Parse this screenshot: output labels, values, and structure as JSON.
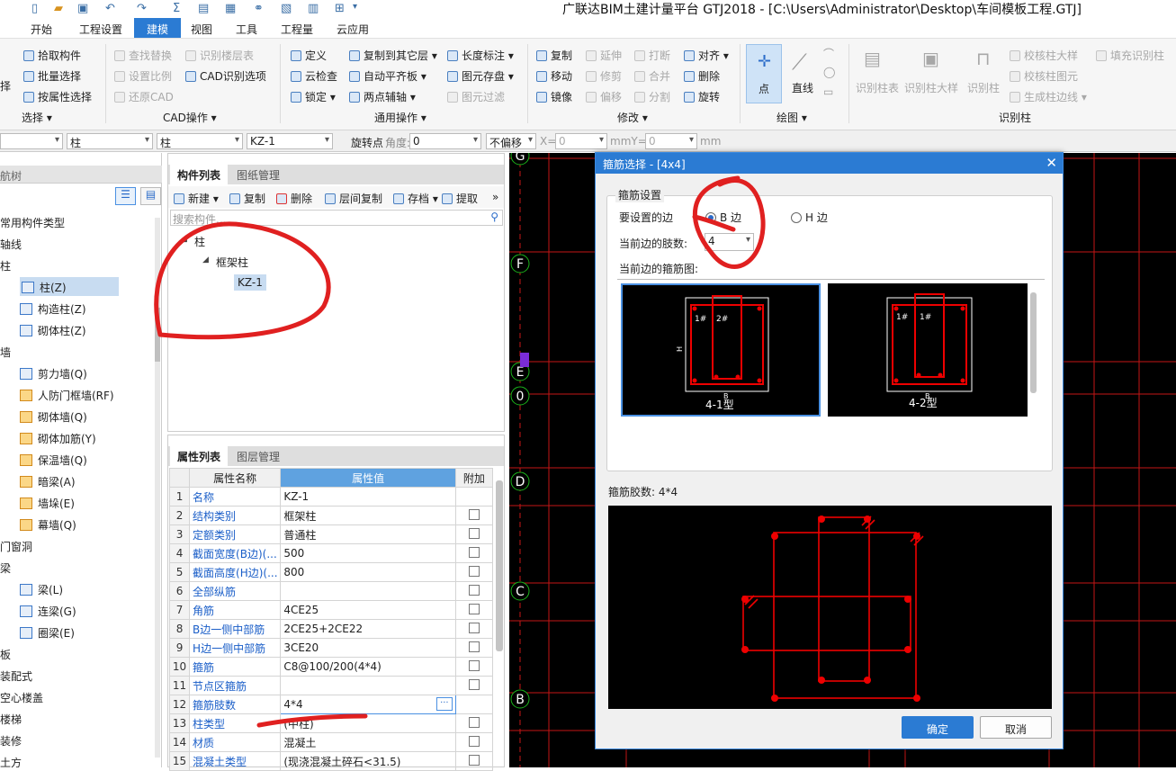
{
  "window": {
    "title": "广联达BIM土建计量平台 GTJ2018 - [C:\\Users\\Administrator\\Desktop\\车间模板工程.GTJ]"
  },
  "menu": [
    "开始",
    "工程设置",
    "建模",
    "视图",
    "工具",
    "工程量",
    "云应用"
  ],
  "ribbon": {
    "select": {
      "items": [
        "拾取构件",
        "批量选择",
        "按属性选择"
      ],
      "left_fragment": "择",
      "group": "选择"
    },
    "cad": {
      "items": [
        "查找替换",
        "设置比例",
        "还原CAD",
        "识别楼层表",
        "CAD识别选项"
      ],
      "group": "CAD操作"
    },
    "common": {
      "items": [
        "定义",
        "云检查",
        "锁定",
        "复制到其它层",
        "自动平齐板",
        "两点辅轴",
        "长度标注",
        "图元存盘",
        "图元过滤"
      ],
      "group": "通用操作"
    },
    "modify": {
      "items": [
        "复制",
        "移动",
        "镜像",
        "延伸",
        "修剪",
        "偏移",
        "打断",
        "合并",
        "分割",
        "对齐",
        "删除",
        "旋转"
      ],
      "group": "修改"
    },
    "draw": {
      "items": [
        "点",
        "直线"
      ],
      "group": "绘图"
    },
    "recognize": {
      "items": [
        "识别柱表",
        "识别柱大样",
        "识别柱",
        "校核柱大样",
        "校核柱图元",
        "生成柱边线",
        "填充识别柱"
      ],
      "group": "识别柱"
    }
  },
  "propbar": {
    "combo1": "柱",
    "combo2": "柱",
    "combo3": "KZ-1",
    "rotate_label": "旋转点",
    "angle_label": "角度:",
    "angle": "0",
    "offset": "不偏移",
    "x_label": "X=",
    "x": "0",
    "mm_y": "mmY=",
    "y": "0",
    "mm": "mm"
  },
  "nav": {
    "title": "航树",
    "items": [
      {
        "label": "常用构件类型",
        "level": 0
      },
      {
        "label": "轴线",
        "level": 0
      },
      {
        "label": "柱",
        "level": 0
      },
      {
        "label": "柱(Z)",
        "level": 1,
        "selected": true
      },
      {
        "label": "构造柱(Z)",
        "level": 1
      },
      {
        "label": "砌体柱(Z)",
        "level": 1
      },
      {
        "label": "墙",
        "level": 0
      },
      {
        "label": "剪力墙(Q)",
        "level": 1
      },
      {
        "label": "人防门框墙(RF)",
        "level": 1
      },
      {
        "label": "砌体墙(Q)",
        "level": 1
      },
      {
        "label": "砌体加筋(Y)",
        "level": 1
      },
      {
        "label": "保温墙(Q)",
        "level": 1
      },
      {
        "label": "暗梁(A)",
        "level": 1
      },
      {
        "label": "墙垛(E)",
        "level": 1
      },
      {
        "label": "幕墙(Q)",
        "level": 1
      },
      {
        "label": "门窗洞",
        "level": 0
      },
      {
        "label": "梁",
        "level": 0
      },
      {
        "label": "梁(L)",
        "level": 1
      },
      {
        "label": "连梁(G)",
        "level": 1
      },
      {
        "label": "圈梁(E)",
        "level": 1
      },
      {
        "label": "板",
        "level": 0
      },
      {
        "label": "装配式",
        "level": 0
      },
      {
        "label": "空心楼盖",
        "level": 0
      },
      {
        "label": "楼梯",
        "level": 0
      },
      {
        "label": "装修",
        "level": 0
      },
      {
        "label": "土方",
        "level": 0
      }
    ]
  },
  "components": {
    "tabs": [
      "构件列表",
      "图纸管理"
    ],
    "toolbar": [
      "新建",
      "复制",
      "删除",
      "层间复制",
      "存档",
      "提取"
    ],
    "search_placeholder": "搜索构件...",
    "tree": [
      "柱",
      "框架柱",
      "KZ-1"
    ]
  },
  "properties": {
    "tabs": [
      "属性列表",
      "图层管理"
    ],
    "headers": [
      "属性名称",
      "属性值",
      "附加"
    ],
    "rows": [
      {
        "n": "1",
        "k": "名称",
        "v": "KZ-1",
        "cb": false
      },
      {
        "n": "2",
        "k": "结构类别",
        "v": "框架柱",
        "cb": true
      },
      {
        "n": "3",
        "k": "定额类别",
        "v": "普通柱",
        "cb": true
      },
      {
        "n": "4",
        "k": "截面宽度(B边)(...",
        "v": "500",
        "cb": true
      },
      {
        "n": "5",
        "k": "截面高度(H边)(...",
        "v": "800",
        "cb": true
      },
      {
        "n": "6",
        "k": "全部纵筋",
        "v": "",
        "cb": true
      },
      {
        "n": "7",
        "k": "角筋",
        "v": "4CE25",
        "cb": true
      },
      {
        "n": "8",
        "k": "B边一侧中部筋",
        "v": "2CE25+2CE22",
        "cb": true
      },
      {
        "n": "9",
        "k": "H边一侧中部筋",
        "v": "3CE20",
        "cb": true
      },
      {
        "n": "10",
        "k": "箍筋",
        "v": "C8@100/200(4*4)",
        "cb": true
      },
      {
        "n": "11",
        "k": "节点区箍筋",
        "v": "",
        "cb": true
      },
      {
        "n": "12",
        "k": "箍筋肢数",
        "v": "4*4",
        "cb": false,
        "selected": true
      },
      {
        "n": "13",
        "k": "柱类型",
        "v": "(中柱)",
        "cb": true
      },
      {
        "n": "14",
        "k": "材质",
        "v": "混凝土",
        "cb": true
      },
      {
        "n": "15",
        "k": "混凝土类型",
        "v": "(现浇混凝土碎石<31.5)",
        "cb": true
      }
    ]
  },
  "axes": [
    "G",
    "F",
    "E",
    "0",
    "D",
    "C",
    "B"
  ],
  "dialog": {
    "title": "箍筋选择 - [4x4]",
    "section": "箍筋设置",
    "edge_label": "要设置的边",
    "edge_b": "B 边",
    "edge_h": "H 边",
    "count_label": "当前边的肢数:",
    "count": "4",
    "diagram_label": "当前边的箍筋图:",
    "options": [
      {
        "name": "4-1型",
        "selected": true
      },
      {
        "name": "4-2型"
      }
    ],
    "legs_label": "箍筋胶数: 4*4",
    "ok": "确定",
    "cancel": "取消"
  },
  "colors": {
    "accent": "#2b7bd3",
    "annotation": "#e02020"
  }
}
